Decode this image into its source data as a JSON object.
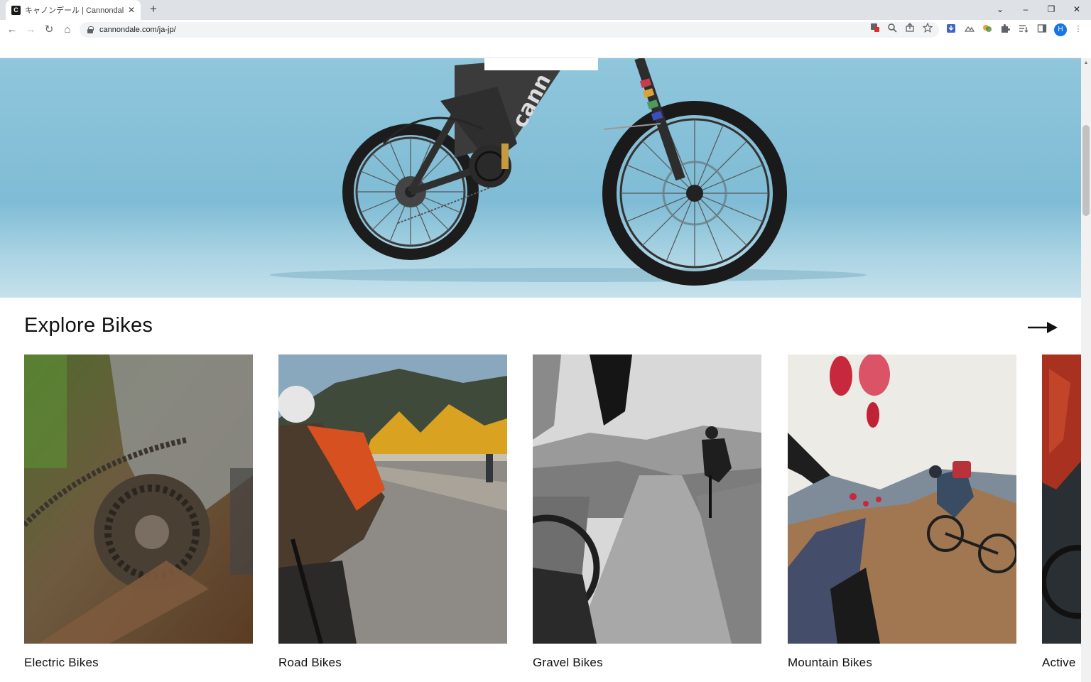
{
  "browser": {
    "tab_title": "キャノンデール | Cannondale Bikes -",
    "favicon_letter": "C",
    "new_tab": "+",
    "url": "cannondale.com/ja-jp/",
    "profile_initial": "H",
    "window_controls": {
      "tab_search": "⌄",
      "minimize": "–",
      "restore": "❐",
      "close": "✕"
    },
    "nav": {
      "back": "←",
      "forward": "→",
      "reload": "↻",
      "home": "⌂"
    }
  },
  "page": {
    "section_title": "Explore Bikes",
    "categories": [
      {
        "label": "Electric Bikes"
      },
      {
        "label": "Road Bikes"
      },
      {
        "label": "Gravel Bikes"
      },
      {
        "label": "Mountain Bikes"
      },
      {
        "label": "Active"
      }
    ]
  },
  "colors": {
    "hero_sky": "#8fc6dc",
    "accent_profile": "#1a73e8",
    "text": "#111111"
  }
}
